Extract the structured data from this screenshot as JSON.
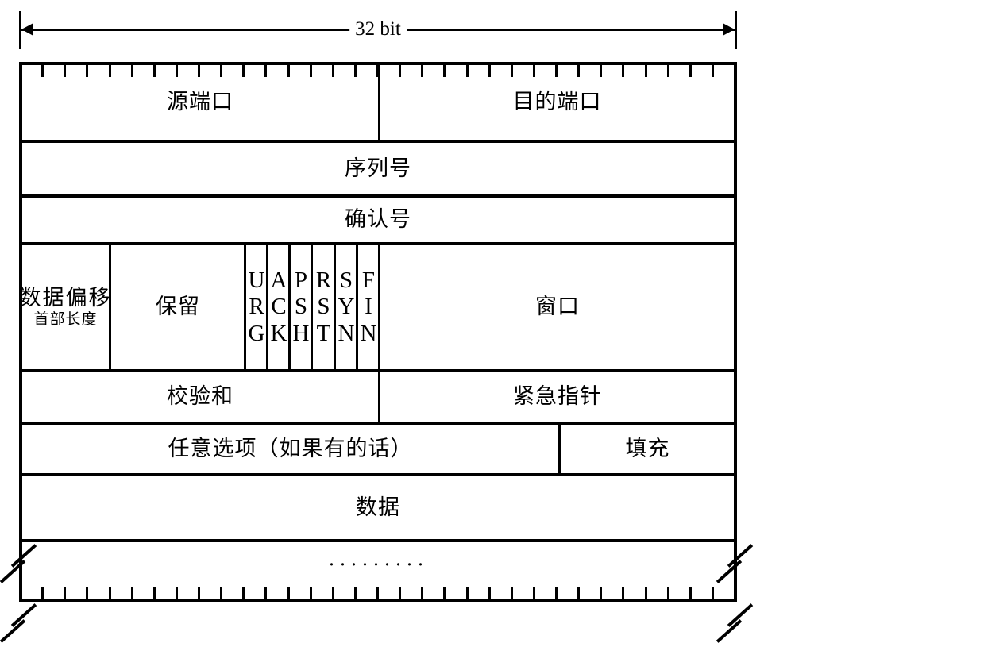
{
  "diagram": {
    "title_scale": "32 bit",
    "rows": [
      {
        "id": "ports",
        "cells": [
          {
            "id": "source-port",
            "label": "源端口"
          },
          {
            "id": "destination-port",
            "label": "目的端口"
          }
        ]
      },
      {
        "id": "sequence",
        "cells": [
          {
            "id": "sequence-number",
            "label": "序列号"
          }
        ]
      },
      {
        "id": "acknowledgement",
        "cells": [
          {
            "id": "acknowledgement-number",
            "label": "确认号"
          }
        ]
      },
      {
        "id": "flags-row",
        "cells": [
          {
            "id": "data-offset",
            "label_main": "数据偏移",
            "label_sub": "首部长度"
          },
          {
            "id": "reserved",
            "label": "保留"
          },
          {
            "id": "window",
            "label": "窗口"
          }
        ],
        "flags": [
          {
            "id": "urg",
            "letters": [
              "U",
              "R",
              "G"
            ]
          },
          {
            "id": "ack",
            "letters": [
              "A",
              "C",
              "K"
            ]
          },
          {
            "id": "psh",
            "letters": [
              "P",
              "S",
              "H"
            ]
          },
          {
            "id": "rst",
            "letters": [
              "R",
              "S",
              "T"
            ]
          },
          {
            "id": "syn",
            "letters": [
              "S",
              "Y",
              "N"
            ]
          },
          {
            "id": "fin",
            "letters": [
              "F",
              "I",
              "N"
            ]
          }
        ]
      },
      {
        "id": "checksum-row",
        "cells": [
          {
            "id": "checksum",
            "label": "校验和"
          },
          {
            "id": "urgent-pointer",
            "label": "紧急指针"
          }
        ]
      },
      {
        "id": "options-row",
        "cells": [
          {
            "id": "options",
            "label": "任意选项（如果有的话）"
          },
          {
            "id": "padding",
            "label": "填充"
          }
        ]
      },
      {
        "id": "data-row",
        "cells": [
          {
            "id": "data",
            "label": "数据"
          }
        ]
      },
      {
        "id": "continuation-row",
        "cells": [
          {
            "id": "continuation",
            "label": "·········"
          }
        ]
      }
    ],
    "ruler": {
      "top_ticks": 32,
      "bottom_ticks": 32
    },
    "colors": {
      "stroke": "#000000",
      "background": "#ffffff"
    }
  }
}
